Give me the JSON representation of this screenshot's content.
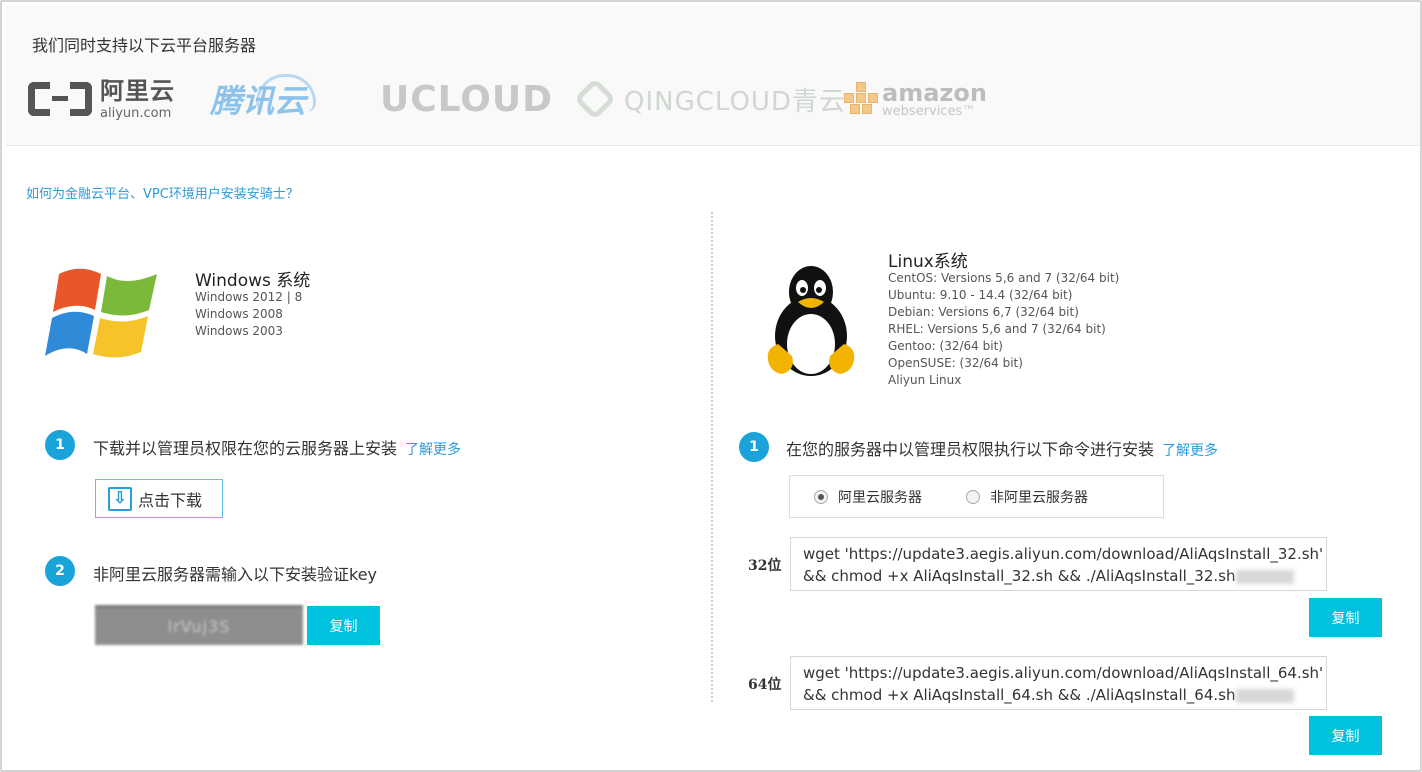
{
  "platforms": {
    "title": "我们同时支持以下云平台服务器",
    "aliyun": {
      "cn": "阿里云",
      "en": "aliyun.com"
    },
    "tencent": {
      "name": "腾讯云"
    },
    "ucloud": {
      "u": "U",
      "rest": "CLOUD"
    },
    "qingcloud": {
      "name": "QINGCLOUD青云"
    },
    "amazon": {
      "name": "amazon",
      "sub": "webservices™"
    }
  },
  "faq_link": "如何为金融云平台、VPC环境用户安装安骑士？",
  "windows": {
    "title": "Windows 系统",
    "versions": [
      "Windows 2012 | 8",
      "Windows 2008",
      "Windows 2003"
    ],
    "step1": {
      "num": "1",
      "text": "下载并以管理员权限在您的云服务器上安装",
      "more": "了解更多"
    },
    "download_label": "点击下载",
    "step2": {
      "num": "2",
      "text": "非阿里云服务器需输入以下安装验证key"
    },
    "key_value": "lrVuj3S",
    "copy_label": "复制"
  },
  "linux": {
    "title": "Linux系统",
    "versions": [
      "CentOS: Versions 5,6 and 7 (32/64 bit)",
      "Ubuntu: 9.10 - 14.4 (32/64 bit)",
      "Debian: Versions 6,7 (32/64 bit)",
      "RHEL: Versions 5,6 and 7 (32/64 bit)",
      "Gentoo: (32/64 bit)",
      "OpenSUSE: (32/64 bit)",
      "Aliyun Linux"
    ],
    "step1": {
      "num": "1",
      "text": "在您的服务器中以管理员权限执行以下命令进行安装",
      "more": "了解更多"
    },
    "radio": {
      "aliyun": "阿里云服务器",
      "non_aliyun": "非阿里云服务器",
      "selected": "aliyun"
    },
    "bit32": {
      "label": "32位",
      "line1": "wget 'https://update3.aegis.aliyun.com/download/AliAqsInstall_32.sh'",
      "line2": "&& chmod +x AliAqsInstall_32.sh && ./AliAqsInstall_32.sh"
    },
    "bit64": {
      "label": "64位",
      "line1": "wget 'https://update3.aegis.aliyun.com/download/AliAqsInstall_64.sh'",
      "line2": "&& chmod +x AliAqsInstall_64.sh && ./AliAqsInstall_64.sh"
    },
    "copy_label": "复制"
  },
  "colors": {
    "accent": "#00c1de",
    "link": "#2d9bd8",
    "step": "#1aa3d8"
  }
}
